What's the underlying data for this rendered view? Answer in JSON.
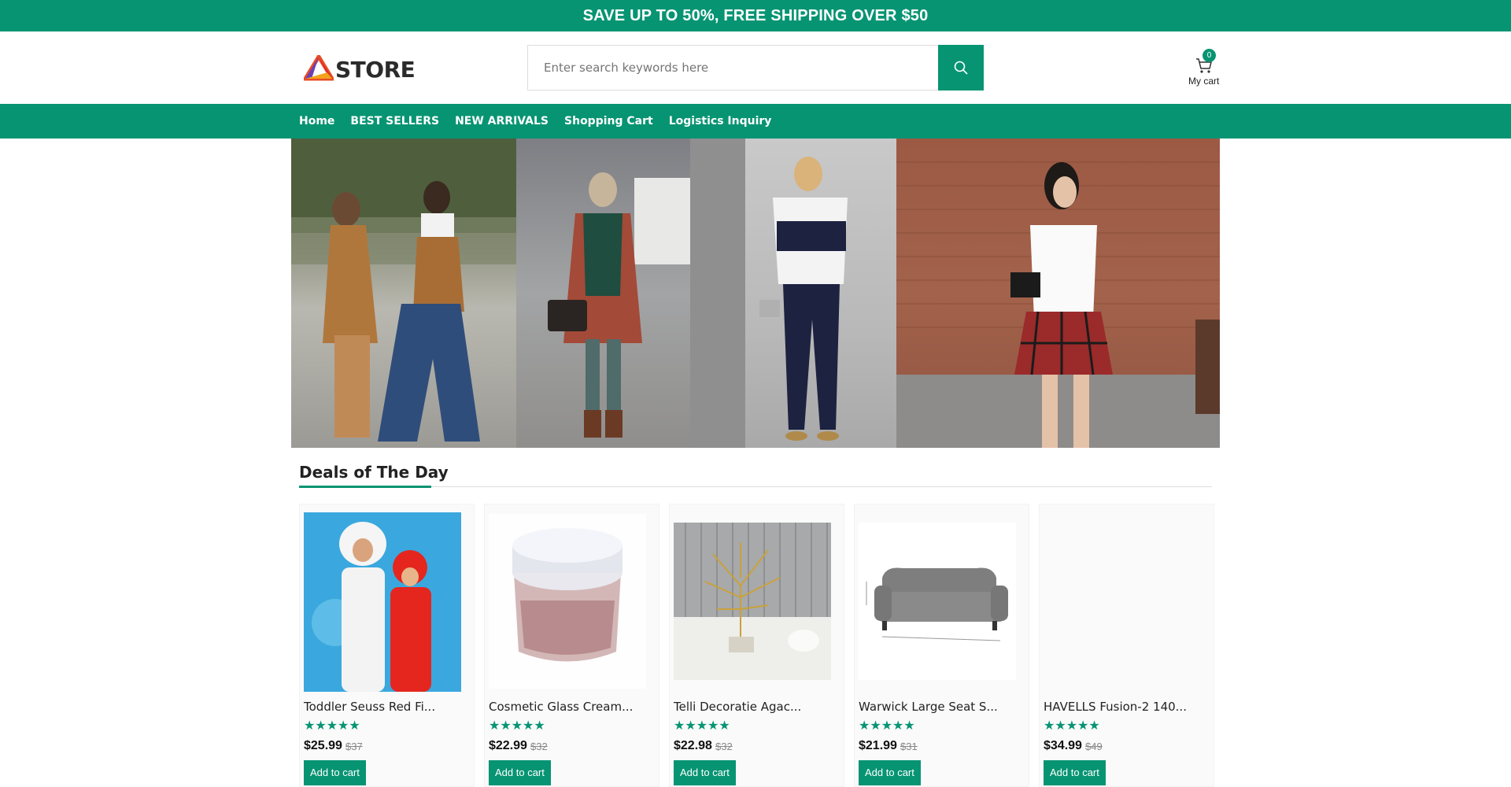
{
  "promo": {
    "text": "SAVE UP TO 50%, FREE SHIPPING OVER $50"
  },
  "brand": {
    "logo_text": "STORE",
    "accent": "#079473"
  },
  "search": {
    "placeholder": "Enter search keywords here",
    "icon": "search-icon"
  },
  "cart": {
    "count": "0",
    "label": "My cart",
    "icon": "cart-icon"
  },
  "nav": {
    "items": [
      "Home",
      "BEST SELLERS",
      "NEW ARRIVALS",
      "Shopping Cart",
      "Logistics Inquiry"
    ]
  },
  "banner": {
    "panels": [
      "street-style-two-women",
      "plaid-scarf-outfit",
      "striped-tee-outfit",
      "plaid-skirt-outfit"
    ]
  },
  "deals": {
    "title": "Deals of The Day",
    "products": [
      {
        "name": "Toddler Seuss Red Fi...",
        "rating": "★★★★★",
        "price": "$25.99",
        "old_price": "$37",
        "button": "Add to cart"
      },
      {
        "name": "Cosmetic Glass Cream...",
        "rating": "★★★★★",
        "price": "$22.99",
        "old_price": "$32",
        "button": "Add to cart"
      },
      {
        "name": "Telli Decoratie Agac...",
        "rating": "★★★★★",
        "price": "$22.98",
        "old_price": "$32",
        "button": "Add to cart"
      },
      {
        "name": "Warwick Large Seat S...",
        "rating": "★★★★★",
        "price": "$21.99",
        "old_price": "$31",
        "button": "Add to cart"
      },
      {
        "name": "HAVELLS Fusion-2 140...",
        "rating": "★★★★★",
        "price": "$34.99",
        "old_price": "$49",
        "button": "Add to cart"
      }
    ]
  }
}
